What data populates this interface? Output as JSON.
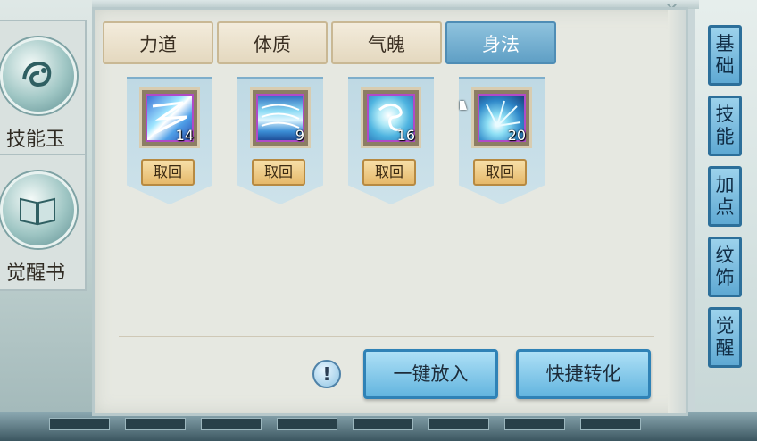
{
  "side_tabs": [
    {
      "label": "技能玉"
    },
    {
      "label": "觉醒书"
    }
  ],
  "top_tabs": [
    {
      "label": "力道",
      "active": false
    },
    {
      "label": "体质",
      "active": false
    },
    {
      "label": "气魄",
      "active": false
    },
    {
      "label": "身法",
      "active": true
    }
  ],
  "skill_cards": [
    {
      "count": "14",
      "button": "取回",
      "icon": "lightning-arc-icon"
    },
    {
      "count": "9",
      "button": "取回",
      "icon": "ice-whirl-icon"
    },
    {
      "count": "16",
      "button": "取回",
      "icon": "spirit-orb-icon"
    },
    {
      "count": "20",
      "button": "取回",
      "icon": "ice-burst-icon"
    }
  ],
  "info_button": {
    "label": "!"
  },
  "actions": {
    "one_click_place": "一键放入",
    "quick_convert": "快捷转化"
  },
  "right_nav": [
    {
      "chars": [
        "基",
        "础"
      ]
    },
    {
      "chars": [
        "技",
        "能"
      ]
    },
    {
      "chars": [
        "加",
        "点"
      ]
    },
    {
      "chars": [
        "纹",
        "饰"
      ]
    },
    {
      "chars": [
        "觉",
        "醒"
      ]
    }
  ],
  "colors": {
    "active_tab": "#5f9fc5",
    "panel_bg": "#e6e8e1",
    "button_gold": "#e6b96a",
    "button_blue": "#63b5df"
  }
}
